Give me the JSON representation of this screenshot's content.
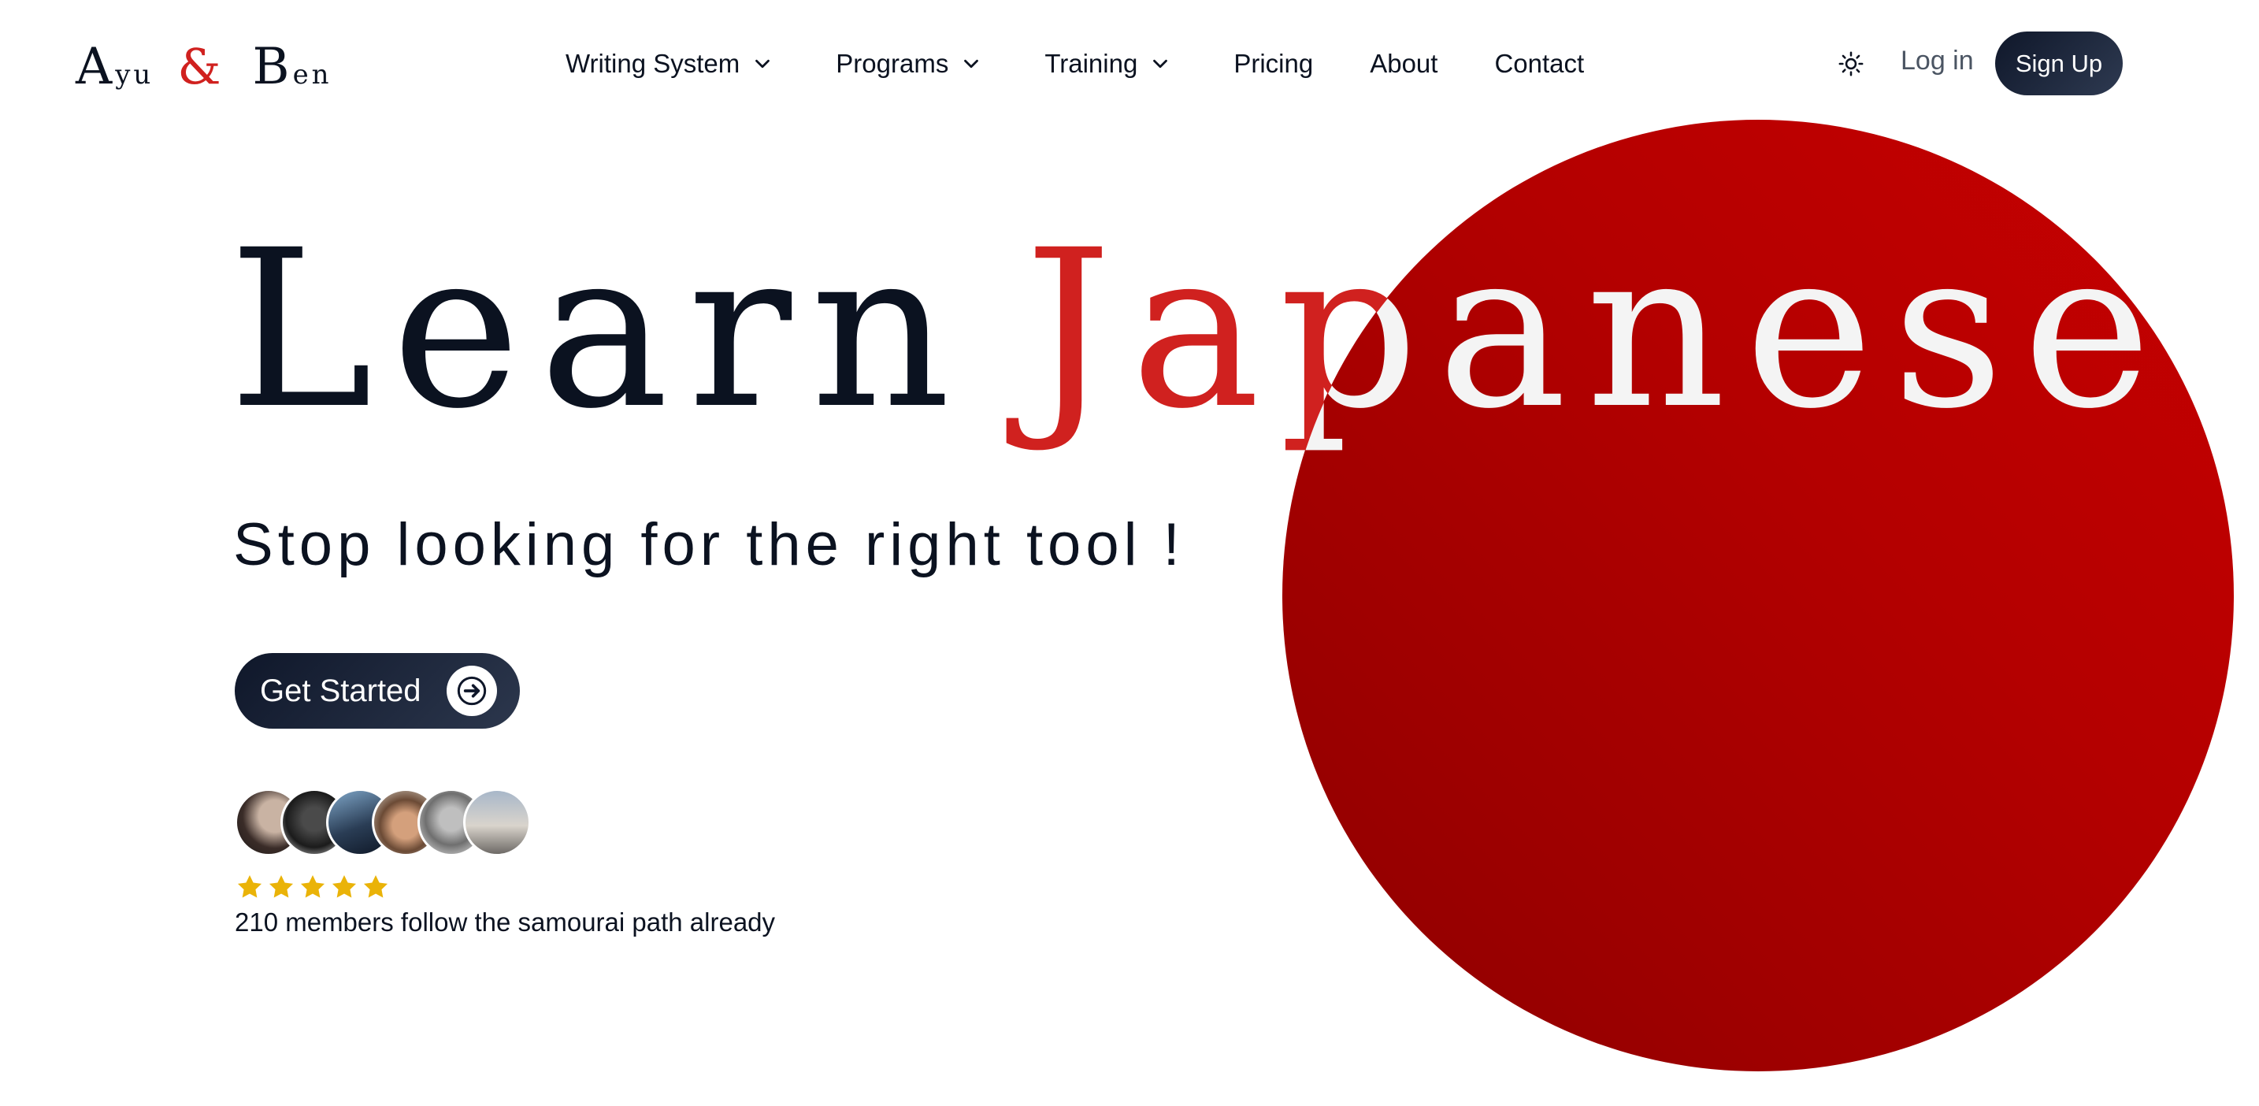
{
  "header": {
    "logo": {
      "first_big": "A",
      "first_small": "yu",
      "ampersand": "&",
      "second_big": "B",
      "second_small": "en"
    },
    "nav": [
      {
        "label": "Writing System",
        "dropdown": true
      },
      {
        "label": "Programs",
        "dropdown": true
      },
      {
        "label": "Training",
        "dropdown": true
      },
      {
        "label": "Pricing",
        "dropdown": false
      },
      {
        "label": "About",
        "dropdown": false
      },
      {
        "label": "Contact",
        "dropdown": false
      }
    ],
    "theme_icon": "sun-icon",
    "login_label": "Log in",
    "signup_label": "Sign Up"
  },
  "hero": {
    "headline_part1": "Learn",
    "headline_part2": "Japanese",
    "subheadline": "Stop looking for the right tool !",
    "cta_label": "Get Started",
    "cta_icon": "arrow-right-icon",
    "rating_stars": 5,
    "social_proof": "210 members follow the samourai path already",
    "avatar_count": 6
  },
  "colors": {
    "brand_red": "#d0211f",
    "sun_red": "#b30000",
    "dark_navy": "#0f172a",
    "star_gold": "#eab308",
    "text_dark": "#0b1220"
  }
}
